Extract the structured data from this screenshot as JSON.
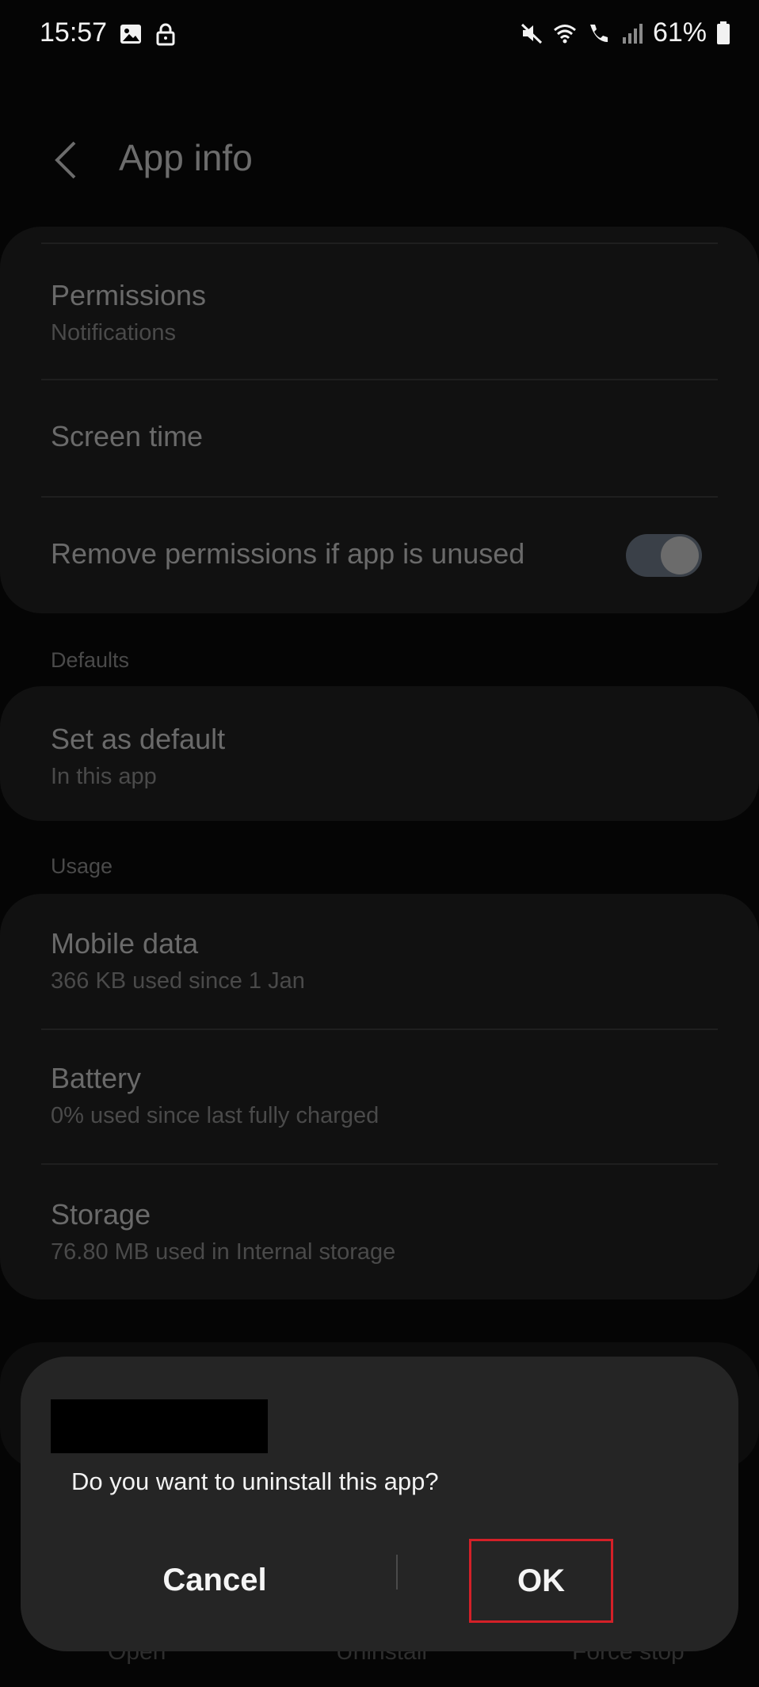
{
  "status_bar": {
    "time": "15:57",
    "battery": "61%",
    "icons": [
      "image-icon",
      "lock-icon",
      "mute-icon",
      "wifi-icon",
      "wifi-calling-icon",
      "signal-icon",
      "battery-icon"
    ]
  },
  "header": {
    "back_icon": "back-arrow-icon",
    "title": "App info"
  },
  "permissions_card": {
    "permissions": {
      "title": "Permissions",
      "subtitle": "Notifications"
    },
    "screen_time": {
      "title": "Screen time"
    },
    "remove_permissions": {
      "title": "Remove permissions if app is unused",
      "toggle_on": true
    }
  },
  "defaults": {
    "section_label": "Defaults",
    "set_as_default": {
      "title": "Set as default",
      "subtitle": "In this app"
    }
  },
  "usage": {
    "section_label": "Usage",
    "mobile_data": {
      "title": "Mobile data",
      "subtitle": "366 KB used since 1 Jan"
    },
    "battery": {
      "title": "Battery",
      "subtitle": "0% used since last fully charged"
    },
    "storage": {
      "title": "Storage",
      "subtitle": "76.80 MB used in Internal storage"
    }
  },
  "bottom_actions": {
    "open": "Open",
    "uninstall": "Uninstall",
    "force_stop": "Force stop"
  },
  "dialog": {
    "message": "Do you want to uninstall this app?",
    "cancel_label": "Cancel",
    "ok_label": "OK"
  },
  "colors": {
    "highlight_border": "#d42028",
    "dialog_bg": "#252525",
    "card_bg": "#111111"
  }
}
